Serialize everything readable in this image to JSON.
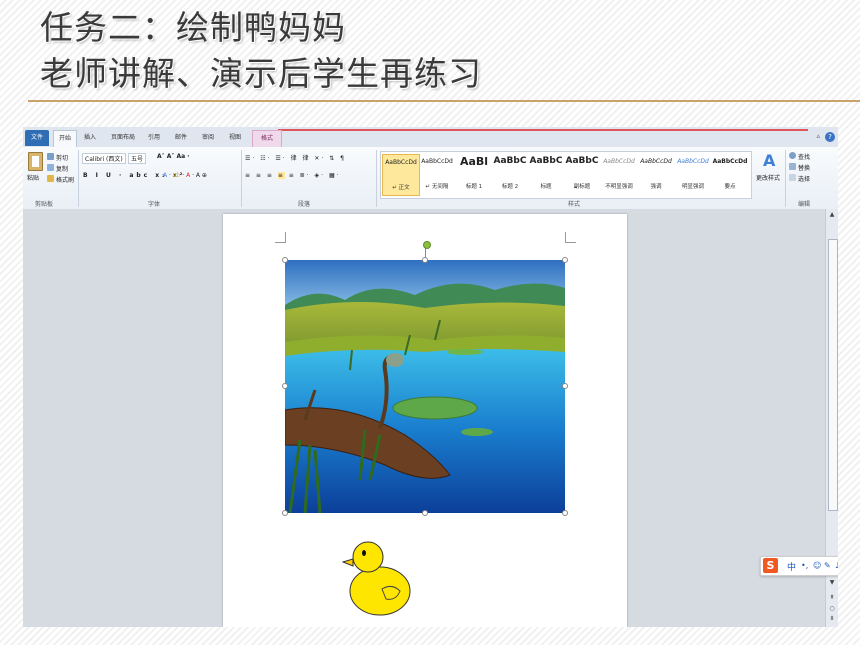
{
  "slide": {
    "title_line1": "任务二：绘制鸭妈妈",
    "title_line2": "老师讲解、演示后学生再练习",
    "accent": "#c9a36b"
  },
  "word": {
    "tabs": [
      "文件",
      "开始",
      "插入",
      "页面布局",
      "引用",
      "邮件",
      "审阅",
      "视图",
      "格式"
    ],
    "ribbon": {
      "clipboard": {
        "paste": "粘贴",
        "cut": "剪切",
        "copy": "复制",
        "format_painter": "格式刷",
        "group": "剪贴板"
      },
      "font": {
        "name": "Calibri (西文)",
        "size": "五号",
        "group": "字体"
      },
      "paragraph": {
        "group": "段落"
      },
      "styles": {
        "group": "样式",
        "items": [
          {
            "preview": "AaBbCcDd",
            "name": "↵ 正文"
          },
          {
            "preview": "AaBbCcDd",
            "name": "↵ 无间隔"
          },
          {
            "preview": "AaBl",
            "name": "标题 1"
          },
          {
            "preview": "AaBbC",
            "name": "标题 2"
          },
          {
            "preview": "AaBbC",
            "name": "标题"
          },
          {
            "preview": "AaBbC",
            "name": "副标题"
          },
          {
            "preview": "AaBbCcDd",
            "name": "不明显强调"
          },
          {
            "preview": "AaBbCcDd",
            "name": "强调"
          },
          {
            "preview": "AaBbCcDd",
            "name": "明显强调"
          },
          {
            "preview": "AaBbCcDd",
            "name": "要点"
          }
        ],
        "change_styles": "更改样式"
      },
      "editing": {
        "find": "查找",
        "replace": "替换",
        "select": "选择",
        "group": "编辑"
      }
    },
    "ime": {
      "mode": "中"
    }
  }
}
